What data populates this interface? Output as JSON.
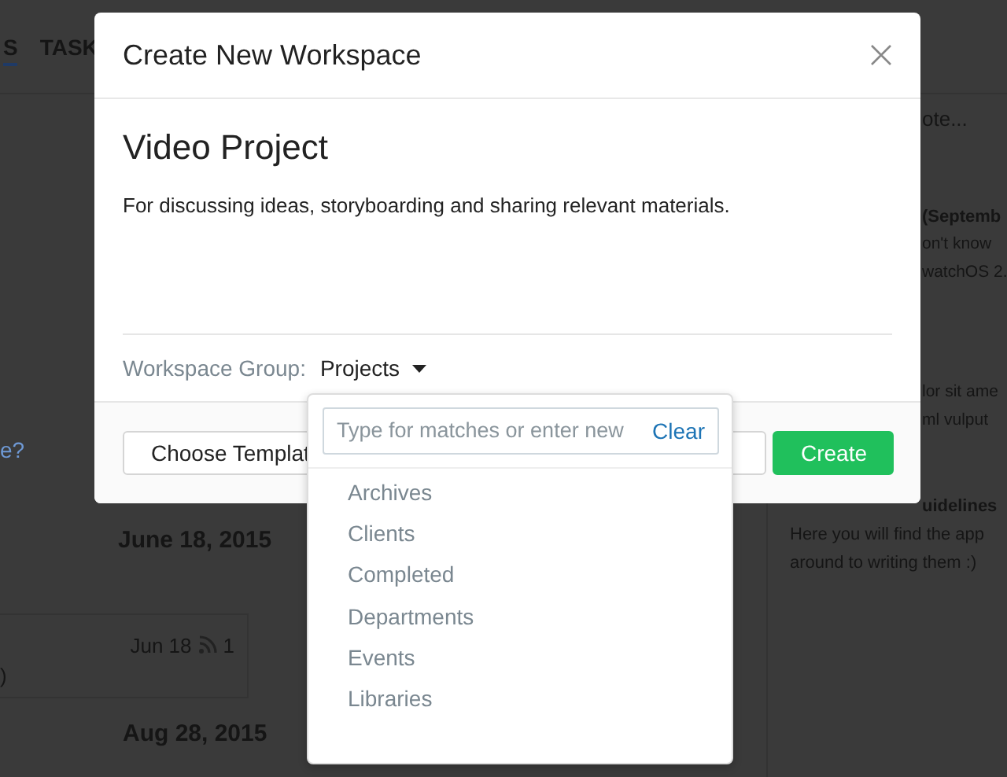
{
  "background": {
    "tabs": [
      {
        "label": "S",
        "selected": true
      },
      {
        "label": "TASK",
        "selected": false
      }
    ],
    "left": {
      "link": "e?",
      "date_1": "June 18, 2015",
      "card": {
        "date": "Jun 18",
        "count": "1",
        "text": ")"
      },
      "date_2": "Aug 28, 2015"
    },
    "right": {
      "note_placeholder": "ote...",
      "items": [
        {
          "title": "(Septemb",
          "lines": [
            "on't know",
            "watchOS 2."
          ]
        },
        {
          "lines": [
            "lor sit ame",
            "ml vulput"
          ]
        },
        {
          "title": "uidelines",
          "lines": [
            "Here you will find the app",
            "around to writing them :)"
          ]
        }
      ]
    }
  },
  "modal": {
    "title": "Create New Workspace",
    "name": "Video Project",
    "description": "For discussing ideas, storyboarding and sharing relevant materials.",
    "group_label": "Workspace Group:",
    "group_value": "Projects",
    "buttons": [
      {
        "kind": "default",
        "label": "Choose Templat"
      },
      {
        "kind": "default"
      },
      {
        "kind": "primary",
        "label": "Create"
      }
    ]
  },
  "dropdown": {
    "search": {
      "placeholder": "Type for matches or enter new"
    },
    "clear": "Clear",
    "options": [
      "Archives",
      "Clients",
      "Completed",
      "Departments",
      "Events",
      "Libraries"
    ]
  }
}
